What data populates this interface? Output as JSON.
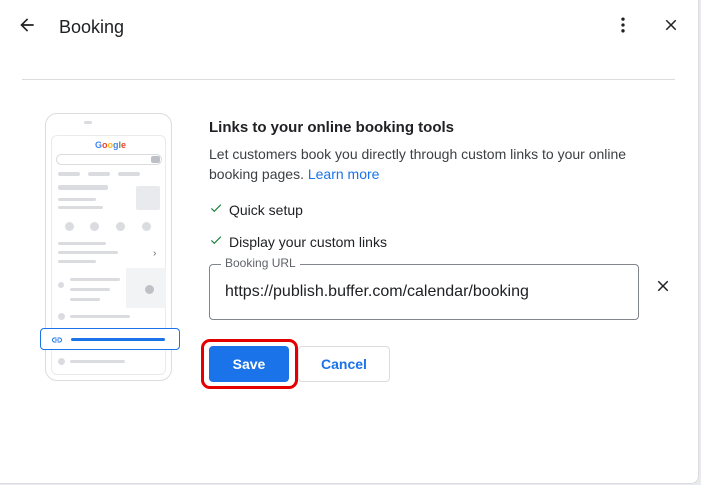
{
  "header": {
    "title": "Booking",
    "back_icon": "arrow-back-icon",
    "more_icon": "more-vert-icon",
    "close_icon": "close-icon"
  },
  "illustration": {
    "search_brand": "Google",
    "icons": [
      "phone-icon",
      "language-icon",
      "bookmark-icon",
      "directions-icon",
      "chevron-right-icon",
      "pin-icon",
      "clock-icon",
      "link-icon",
      "globe-icon",
      "map-pin-icon"
    ]
  },
  "content": {
    "heading": "Links to your online booking tools",
    "description": "Let customers book you directly through custom links to your online booking pages.",
    "learn_more": "Learn more",
    "features": [
      "Quick setup",
      "Display your custom links"
    ],
    "field_label": "Booking URL",
    "field_value": "https://publish.buffer.com/calendar/booking"
  },
  "actions": {
    "save": "Save",
    "cancel": "Cancel"
  },
  "colors": {
    "accent": "#1a73e8",
    "check": "#188038",
    "highlight": "#e50000"
  }
}
